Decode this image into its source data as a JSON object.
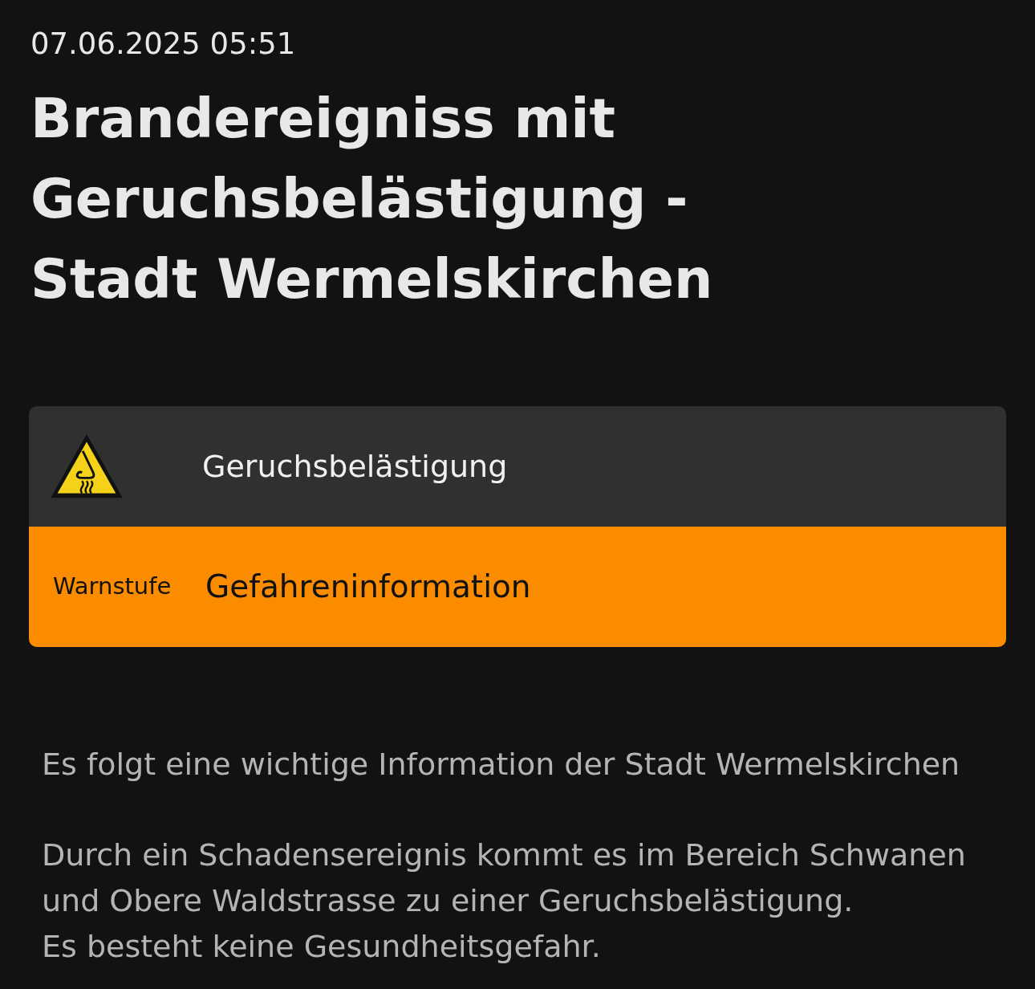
{
  "date": "07.06.2025 05:51",
  "title": "Brandereigniss mit Geruchsbelästigung - Stadt Wermelskirchen",
  "event": {
    "label": "Geruchsbelästigung"
  },
  "warning": {
    "label": "Warnstufe",
    "value": "Gefahreninformation",
    "color": "#fb8c00"
  },
  "paragraphs": [
    [
      "Es folgt eine wichtige Information der Stadt Wermelskirchen"
    ],
    [
      "Durch ein Schadensereignis kommt es im Bereich Schwanen und Obere Waldstrasse zu einer Geruchsbelästigung.",
      "Es besteht keine Gesundheitsgefahr."
    ]
  ]
}
